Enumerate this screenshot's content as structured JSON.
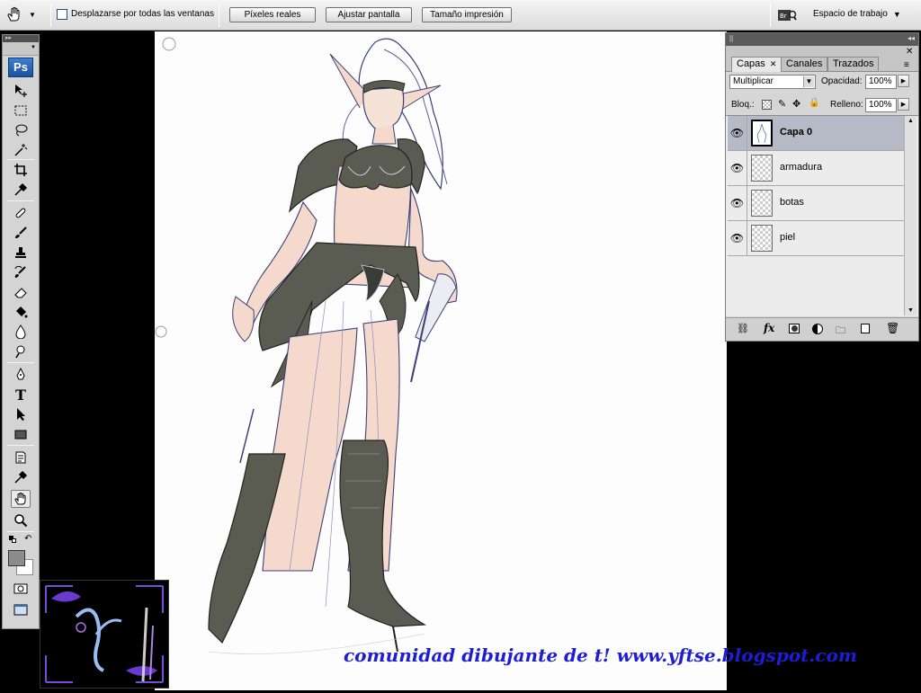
{
  "options_bar": {
    "scroll_all_windows_label": "Desplazarse por todas las ventanas",
    "scroll_all_windows_checked": false,
    "btn_actual_pixels": "Píxeles reales",
    "btn_fit_screen": "Ajustar pantalla",
    "btn_print_size": "Tamaño impresión",
    "workspace_label": "Espacio de trabajo"
  },
  "toolbox": {
    "logo": "Ps",
    "tools": [
      {
        "name": "move-tool",
        "icon": "move-icon"
      },
      {
        "name": "marquee-tool",
        "icon": "marquee-icon"
      },
      {
        "name": "lasso-tool",
        "icon": "lasso-icon"
      },
      {
        "name": "magic-wand-tool",
        "icon": "magic-wand-icon"
      },
      {
        "name": "crop-tool",
        "icon": "crop-icon"
      },
      {
        "name": "eyedropper-tool",
        "icon": "eyedropper-icon"
      },
      {
        "name": "healing-brush-tool",
        "icon": "bandage-icon"
      },
      {
        "name": "brush-tool",
        "icon": "brush-icon"
      },
      {
        "name": "clone-stamp-tool",
        "icon": "stamp-icon"
      },
      {
        "name": "history-brush-tool",
        "icon": "history-brush-icon"
      },
      {
        "name": "eraser-tool",
        "icon": "eraser-icon"
      },
      {
        "name": "paint-bucket-tool",
        "icon": "bucket-icon"
      },
      {
        "name": "blur-tool",
        "icon": "drop-icon"
      },
      {
        "name": "dodge-tool",
        "icon": "dodge-icon"
      },
      {
        "name": "pen-tool",
        "icon": "pen-icon"
      },
      {
        "name": "type-tool",
        "icon": "type-icon",
        "glyph": "T"
      },
      {
        "name": "path-selection-tool",
        "icon": "arrow-icon"
      },
      {
        "name": "rectangle-tool",
        "icon": "rectangle-icon"
      },
      {
        "name": "notes-tool",
        "icon": "note-icon"
      },
      {
        "name": "color-sampler-tool",
        "icon": "eyedropper-icon"
      },
      {
        "name": "hand-tool",
        "icon": "hand-icon",
        "active": true
      },
      {
        "name": "zoom-tool",
        "icon": "magnifier-icon"
      }
    ],
    "foreground_color": "#8c8c8c",
    "background_color": "#ffffff"
  },
  "layers_panel": {
    "tabs": [
      {
        "label": "Capas",
        "active": true,
        "closable": true
      },
      {
        "label": "Canales",
        "active": false
      },
      {
        "label": "Trazados",
        "active": false
      }
    ],
    "blend_mode": "Multiplicar",
    "opacity_label": "Opacidad:",
    "opacity_value": "100%",
    "lock_label": "Bloq.:",
    "fill_label": "Relleno:",
    "fill_value": "100%",
    "layers": [
      {
        "name": "Capa 0",
        "selected": true,
        "visible": true
      },
      {
        "name": "armadura",
        "selected": false,
        "visible": true
      },
      {
        "name": "botas",
        "selected": false,
        "visible": true
      },
      {
        "name": "piel",
        "selected": false,
        "visible": true
      }
    ],
    "footer_icons": [
      "link-icon",
      "fx-icon",
      "mask-icon",
      "adjustment-icon",
      "folder-icon",
      "new-layer-icon",
      "trash-icon"
    ]
  },
  "watermark": {
    "text": "comunidad dibujante de t! www.yftse.blogspot.com",
    "color": "#1d1dd6"
  },
  "colors": {
    "armor": "#5a5c52",
    "skin": "#f4d9cc",
    "sketch_line": "#4a4e86",
    "selected_layer": "#b6bac7"
  }
}
